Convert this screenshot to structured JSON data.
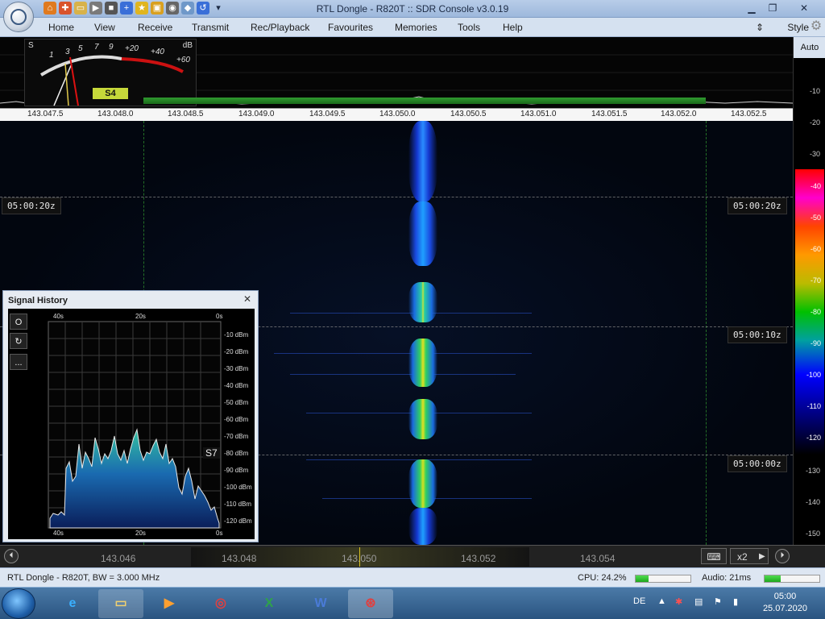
{
  "window": {
    "title": "RTL Dongle - R820T :: SDR Console v3.0.19",
    "buttons": [
      "minimize",
      "restore",
      "close"
    ]
  },
  "quick_access": [
    "home-icon",
    "lifebuoy-icon",
    "folder-icon",
    "play-icon",
    "stop-icon",
    "plus-icon",
    "star-icon",
    "lock-icon",
    "camera-icon",
    "drop-icon",
    "undo-icon",
    "dropdown-icon"
  ],
  "menu": {
    "items": [
      "Home",
      "View",
      "Receive",
      "Transmit",
      "Rec/Playback",
      "Favourites",
      "Memories",
      "Tools",
      "Help"
    ],
    "style_label": "Style"
  },
  "meter": {
    "s_label": "S",
    "db_label": "dB",
    "scale": [
      "1",
      "3",
      "5",
      "7",
      "9",
      "+20",
      "+40",
      "+60"
    ],
    "reading": "S4"
  },
  "frequency_ruler": [
    "143.047.5",
    "143.048.0",
    "143.048.5",
    "143.049.0",
    "143.049.5",
    "143.050.0",
    "143.050.5",
    "143.051.0",
    "143.051.5",
    "143.052.0",
    "143.052.5"
  ],
  "waterfall": {
    "time_markers": [
      "05:00:20z",
      "05:00:10z",
      "05:00:00z"
    ]
  },
  "db_scale": {
    "auto_label": "Auto",
    "top_ticks": [
      "-10",
      "-20",
      "-30"
    ],
    "gradient_ticks": [
      "-40",
      "-50",
      "-60",
      "-70",
      "-80",
      "-90",
      "-100",
      "-110",
      "-120"
    ],
    "bottom_ticks": [
      "-130",
      "-140",
      "-150"
    ],
    "colors": {
      "high": "#ff0000",
      "mid": "#00c000",
      "low": "#0000ff"
    }
  },
  "signal_history": {
    "title": "Signal History",
    "top_time_labels": [
      "40s",
      "20s",
      "0s"
    ],
    "bottom_time_labels": [
      "40s",
      "20s",
      "0s"
    ],
    "db_labels": [
      "-10 dBm",
      "-20 dBm",
      "-30 dBm",
      "-40 dBm",
      "-50 dBm",
      "-60 dBm",
      "-70 dBm",
      "-80 dBm",
      "-90 dBm",
      "-100 dBm",
      "-110 dBm",
      "-120 dBm"
    ],
    "peak_label": "S7",
    "side_buttons": [
      "O",
      "↻",
      "..."
    ]
  },
  "bottom_bar": {
    "freqs": [
      "143.046",
      "143.048",
      "143.050",
      "143.052",
      "143.054"
    ],
    "zoom": "x2"
  },
  "status": {
    "left": "RTL Dongle - R820T, BW = 3.000 MHz",
    "cpu": "CPU: 24.2%",
    "cpu_fraction": 0.242,
    "audio": "Audio: 21ms",
    "audio_fraction": 0.3
  },
  "taskbar": {
    "apps": [
      "ie-icon",
      "explorer-icon",
      "media-icon",
      "chrome-icon",
      "excel-icon",
      "word-icon",
      "sdr-console-icon"
    ],
    "lang": "DE",
    "time": "05:00",
    "date": "25.07.2020"
  }
}
